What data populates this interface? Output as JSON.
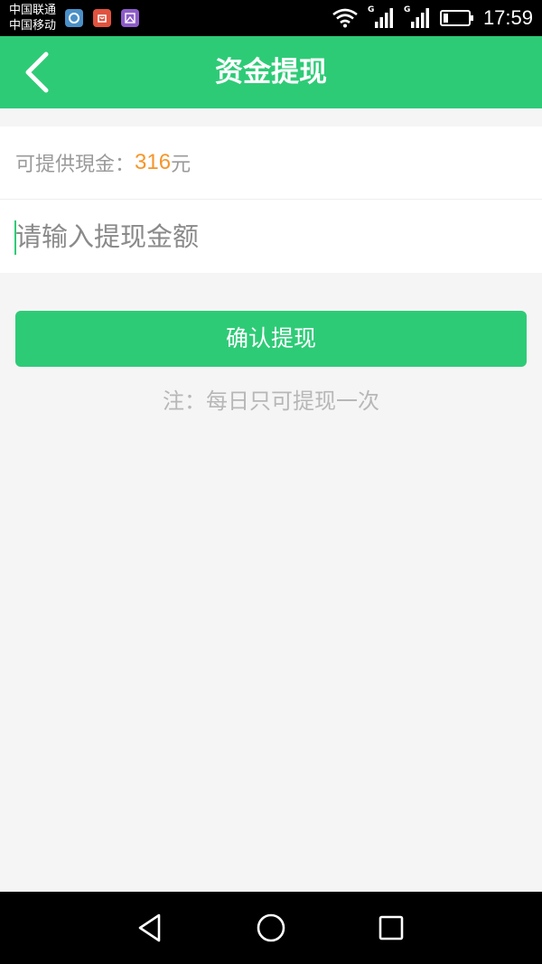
{
  "status_bar": {
    "carrier_1": "中国联通",
    "carrier_2": "中国移动",
    "network_1": "G",
    "network_2": "G",
    "time": "17:59"
  },
  "header": {
    "title": "资金提现",
    "background_color": "#2ecb77"
  },
  "balance": {
    "label": "可提供現金：",
    "amount": "316",
    "unit": "元",
    "amount_color": "#f5962a"
  },
  "withdraw_input": {
    "value": "",
    "placeholder": "请输入提现金额"
  },
  "confirm_button": {
    "label": "确认提现"
  },
  "note": "注：每日只可提现一次",
  "icons": {
    "back": "chevron-left-icon",
    "nav_back": "triangle-back-icon",
    "nav_home": "circle-home-icon",
    "nav_recent": "square-recent-icon"
  }
}
